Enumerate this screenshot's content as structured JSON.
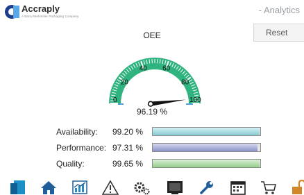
{
  "header": {
    "brand_name": "Accraply",
    "brand_tagline": "A Barry-Wehmiller Packaging Company",
    "page_title": "- Analytics",
    "reset_label": "Reset"
  },
  "gauge": {
    "title": "OEE",
    "value_text": "96.19 %",
    "value": 96.19,
    "min": 0,
    "max": 100,
    "tick_labels": [
      "0",
      "20",
      "40",
      "60",
      "80",
      "100"
    ],
    "color": "#2fb37f"
  },
  "metrics": [
    {
      "label": "Availability:",
      "value_text": "99.20 %",
      "value": 99.2,
      "color": "#86c9d0"
    },
    {
      "label": "Performance:",
      "value_text": "97.31 %",
      "value": 97.31,
      "color": "#8b91c9"
    },
    {
      "label": "Quality:",
      "value_text": "99.65 %",
      "value": 99.65,
      "color": "#96cd8b"
    }
  ],
  "toolbar": {
    "icons": [
      "panel-icon",
      "home-icon",
      "analytics-chart-icon",
      "warning-icon",
      "settings-gears-icon",
      "monitor-icon",
      "wrench-icon",
      "calendar-icon",
      "cart-icon",
      "unlock-icon"
    ]
  }
}
